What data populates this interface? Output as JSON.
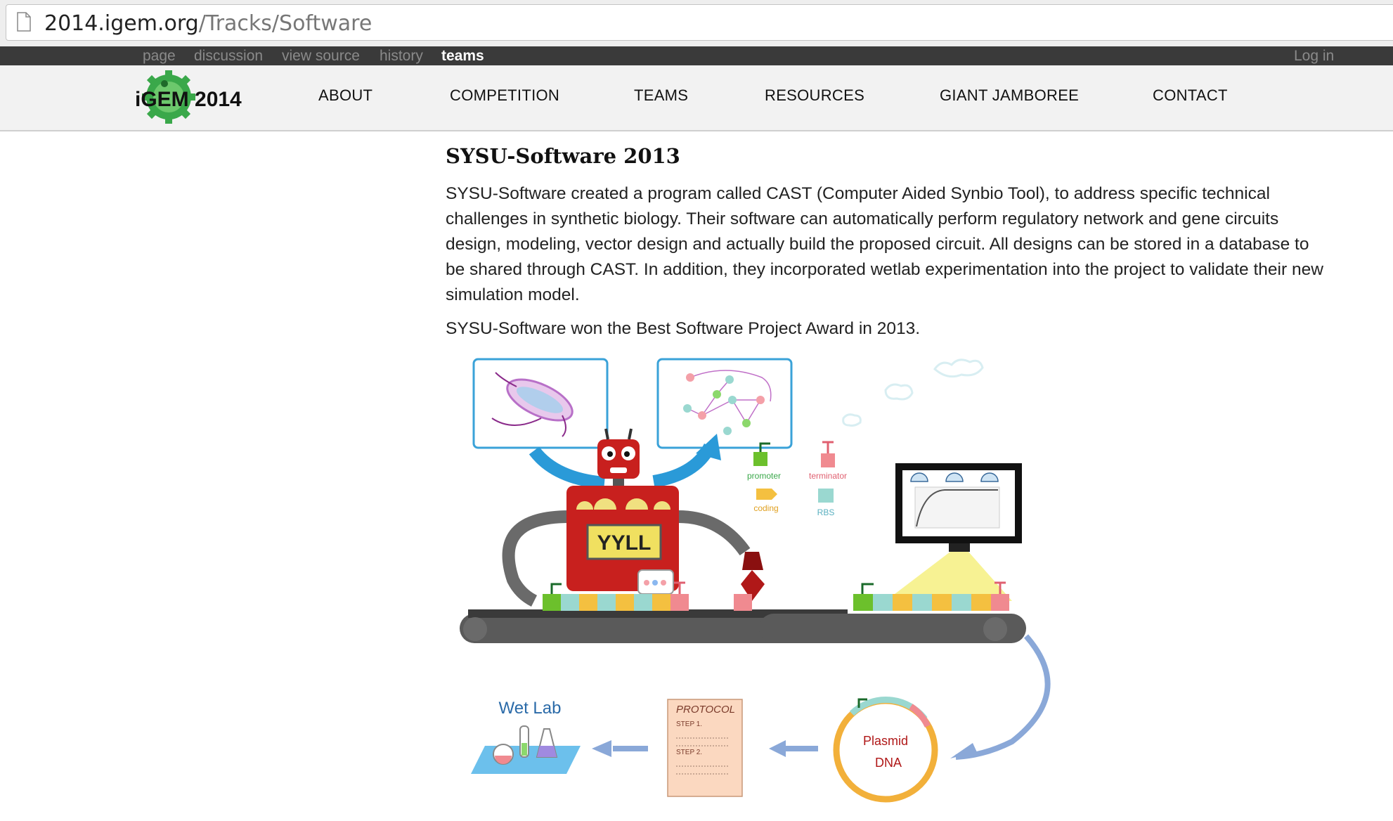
{
  "browser": {
    "url_domain": "2014.igem.org",
    "url_path": "/Tracks/Software"
  },
  "wiki_bar": {
    "tabs": [
      "page",
      "discussion",
      "view source",
      "history",
      "teams"
    ],
    "active_tab": "teams",
    "login": "Log in"
  },
  "header": {
    "logo_text": "iGEM 2014",
    "nav": [
      "ABOUT",
      "COMPETITION",
      "TEAMS",
      "RESOURCES",
      "GIANT JAMBOREE",
      "CONTACT"
    ]
  },
  "main": {
    "title": "SYSU-Software 2013",
    "paragraph1": "SYSU-Software created a program called CAST (Computer Aided Synbio Tool), to address specific technical challenges in synthetic biology. Their software can automatically perform regulatory network and gene circuits design, modeling, vector design and actually build the proposed circuit. All designs can be stored in a database to be shared through CAST. In addition, they incorporated wetlab experimentation into the project to validate their new simulation model.",
    "paragraph2": "SYSU-Software won the Best Software Project Award in 2013."
  },
  "illustration": {
    "robot_display": "YYLL",
    "legend": {
      "promoter": "promoter",
      "coding": "coding",
      "terminator": "terminator",
      "rbs": "RBS"
    },
    "wet_lab": "Wet Lab",
    "protocol_title": "PROTOCOL",
    "protocol_step1": "STEP 1.",
    "protocol_step2": "STEP 2.",
    "plasmid_line1": "Plasmid",
    "plasmid_line2": "DNA"
  },
  "colors": {
    "nav_bg": "#f2f2f2",
    "topbar_bg": "#3a3a3a",
    "logo_green": "#3aa84a",
    "robot_red": "#c8201e",
    "arrow_blue": "#2a9ad8",
    "flow_blue": "#8aa8d8"
  }
}
